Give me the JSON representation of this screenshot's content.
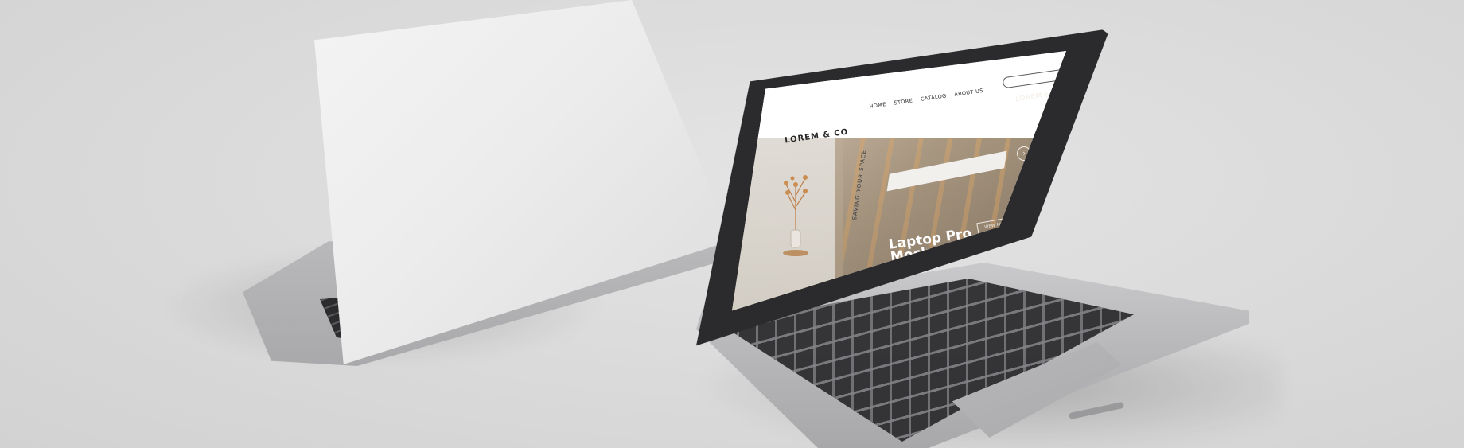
{
  "scene": {
    "background_color": "#dcdcdc",
    "laptop_color": "#c9c9cb"
  },
  "website": {
    "brand": "LOREM & CO",
    "nav": [
      "HOME",
      "STORE",
      "CATALOG",
      "ABOUT US"
    ],
    "search_icon": "search-icon",
    "tagline_vertical": "SAVING YOUR SPACE",
    "brand_overlay": "LOREM & CO",
    "headline_line1": "Laptop Pro",
    "headline_line2": "Mockup",
    "button_label": "VIEW MORE",
    "arrow": "›"
  }
}
